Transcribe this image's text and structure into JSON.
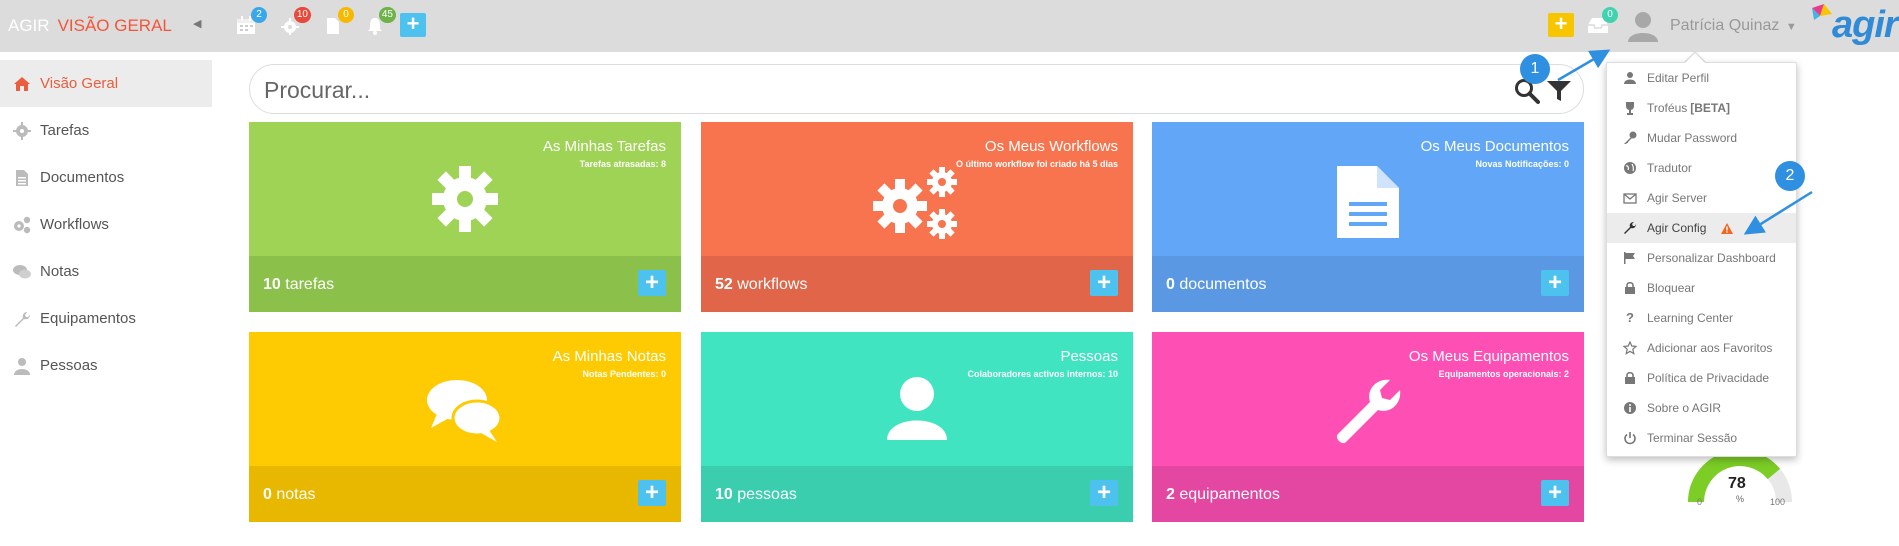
{
  "topbar": {
    "brand": "AGIR",
    "page": "VISÃO GERAL",
    "badges": {
      "calendar": "2",
      "settings": "10",
      "documents": "0",
      "notifications": "45",
      "inbox": "0"
    },
    "user_name": "Patrícia Quinaz",
    "logo_text": "agir"
  },
  "sidebar": {
    "items": [
      {
        "label": "Visão Geral",
        "icon": "home-icon"
      },
      {
        "label": "Tarefas",
        "icon": "gear-icon"
      },
      {
        "label": "Documentos",
        "icon": "document-icon"
      },
      {
        "label": "Workflows",
        "icon": "gears-icon"
      },
      {
        "label": "Notas",
        "icon": "comments-icon"
      },
      {
        "label": "Equipamentos",
        "icon": "wrench-icon"
      },
      {
        "label": "Pessoas",
        "icon": "user-icon"
      }
    ]
  },
  "search": {
    "placeholder": "Procurar..."
  },
  "tiles": [
    {
      "title": "As Minhas Tarefas",
      "subtitle": "Tarefas atrasadas: 8",
      "count": "10",
      "unit": "tarefas",
      "color": "#9fd356",
      "foot": "#8bc14b"
    },
    {
      "title": "Os Meus Workflows",
      "subtitle": "O último workflow foi criado há 5 dias",
      "count": "52",
      "unit": "workflows",
      "color": "#f8744e",
      "foot": "#e06549"
    },
    {
      "title": "Os Meus Documentos",
      "subtitle": "Novas Notificações: 0",
      "count": "0",
      "unit": "documentos",
      "color": "#62a7f7",
      "foot": "#5a98e3"
    },
    {
      "title": "As Minhas Notas",
      "subtitle": "Notas Pendentes: 0",
      "count": "0",
      "unit": "notas",
      "color": "#fecb02",
      "foot": "#e8b800"
    },
    {
      "title": "Pessoas",
      "subtitle": "Colaboradores activos internos: 10",
      "count": "10",
      "unit": "pessoas",
      "color": "#41e4c1",
      "foot": "#3acdae"
    },
    {
      "title": "Os Meus Equipamentos",
      "subtitle": "Equipamentos operacionais: 2",
      "count": "2",
      "unit": "equipamentos",
      "color": "#fe4fb4",
      "foot": "#e347a2"
    }
  ],
  "gauge": {
    "value": "78",
    "unit": "%",
    "min": "0",
    "max": "100"
  },
  "user_menu": {
    "items": [
      {
        "label": "Editar Perfil",
        "icon": "user-icon"
      },
      {
        "label": "Troféus",
        "extra": "[BETA]",
        "icon": "trophy-icon"
      },
      {
        "label": "Mudar Password",
        "icon": "key-icon"
      },
      {
        "label": "Tradutor",
        "icon": "globe-icon"
      },
      {
        "label": "Agir Server",
        "icon": "envelope-icon"
      },
      {
        "label": "Agir Config",
        "icon": "wrench-icon",
        "warning": true
      },
      {
        "label": "Personalizar Dashboard",
        "icon": "flag-icon"
      },
      {
        "label": "Bloquear",
        "icon": "lock-icon"
      },
      {
        "label": "Learning Center",
        "icon": "question-icon"
      },
      {
        "label": "Adicionar aos Favoritos",
        "icon": "star-icon"
      },
      {
        "label": "Política de Privacidade",
        "icon": "lock-icon"
      },
      {
        "label": "Sobre o AGIR",
        "icon": "info-icon"
      },
      {
        "label": "Terminar Sessão",
        "icon": "power-icon"
      }
    ]
  },
  "callouts": [
    "1",
    "2"
  ],
  "colors": {
    "accent": "#e85e3e",
    "callout": "#2f8fe0",
    "add_button": "#4ec2ef"
  }
}
